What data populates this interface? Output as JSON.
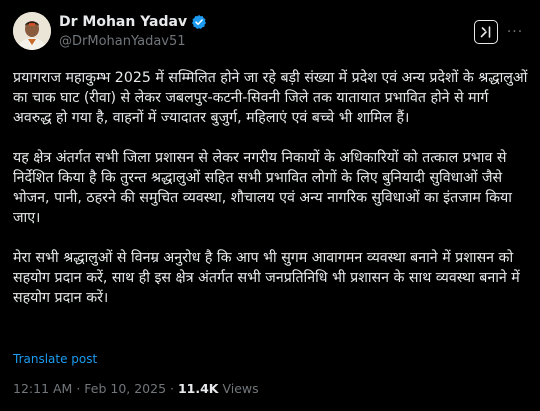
{
  "author": {
    "display_name": "Dr Mohan Yadav",
    "handle": "@DrMohanYadav51",
    "verified": true,
    "verified_color": "#1d9bf0",
    "avatar_icon": "profile-photo"
  },
  "actions": {
    "grok_icon": "grok-icon",
    "more_icon": "more-icon",
    "more_label": "···"
  },
  "post": {
    "paragraphs": [
      "प्रयागराज महाकुम्भ 2025 में सम्मिलित होने जा रहे बड़ी संख्या में प्रदेश एवं अन्य प्रदेशों के श्रद्धालुओं का चाक घाट (रीवा) से लेकर जबलपुर-कटनी-सिवनी जिले तक यातायात प्रभावित होने से मार्ग अवरुद्ध हो गया है, वाहनों में ज्यादातर बुजुर्ग, महिलाएं एवं बच्चे भी शामिल हैं।",
      "यह क्षेत्र अंतर्गत सभी जिला प्रशासन से लेकर नगरीय निकायों के अधिकारियों को तत्काल प्रभाव से निर्देशित किया है कि तुरन्त श्रद्धालुओं सहित सभी प्रभावित लोगों के लिए बुनियादी सुविधाओं जैसे भोजन, पानी, ठहरने की समुचित व्यवस्था, शौचालय एवं अन्य नागरिक सुविधाओं का इंतजाम किया जाए।",
      "मेरा सभी श्रद्धालुओं से विनम्र अनुरोध है कि आप भी सुगम आवागमन व्यवस्था बनाने में प्रशासन को सहयोग प्रदान करें, साथ ही इस क्षेत्र अंतर्गत सभी जनप्रतिनिधि भी प्रशासन के साथ व्यवस्था बनाने में सहयोग प्रदान करें।"
    ],
    "translate_label": "Translate post"
  },
  "meta": {
    "time": "12:11 AM",
    "separator": " · ",
    "date": "Feb 10, 2025",
    "views_count": "11.4K",
    "views_label": " Views"
  },
  "colors": {
    "background": "#000000",
    "text": "#e7e9ea",
    "secondary": "#71767b",
    "link": "#1d9bf0"
  }
}
